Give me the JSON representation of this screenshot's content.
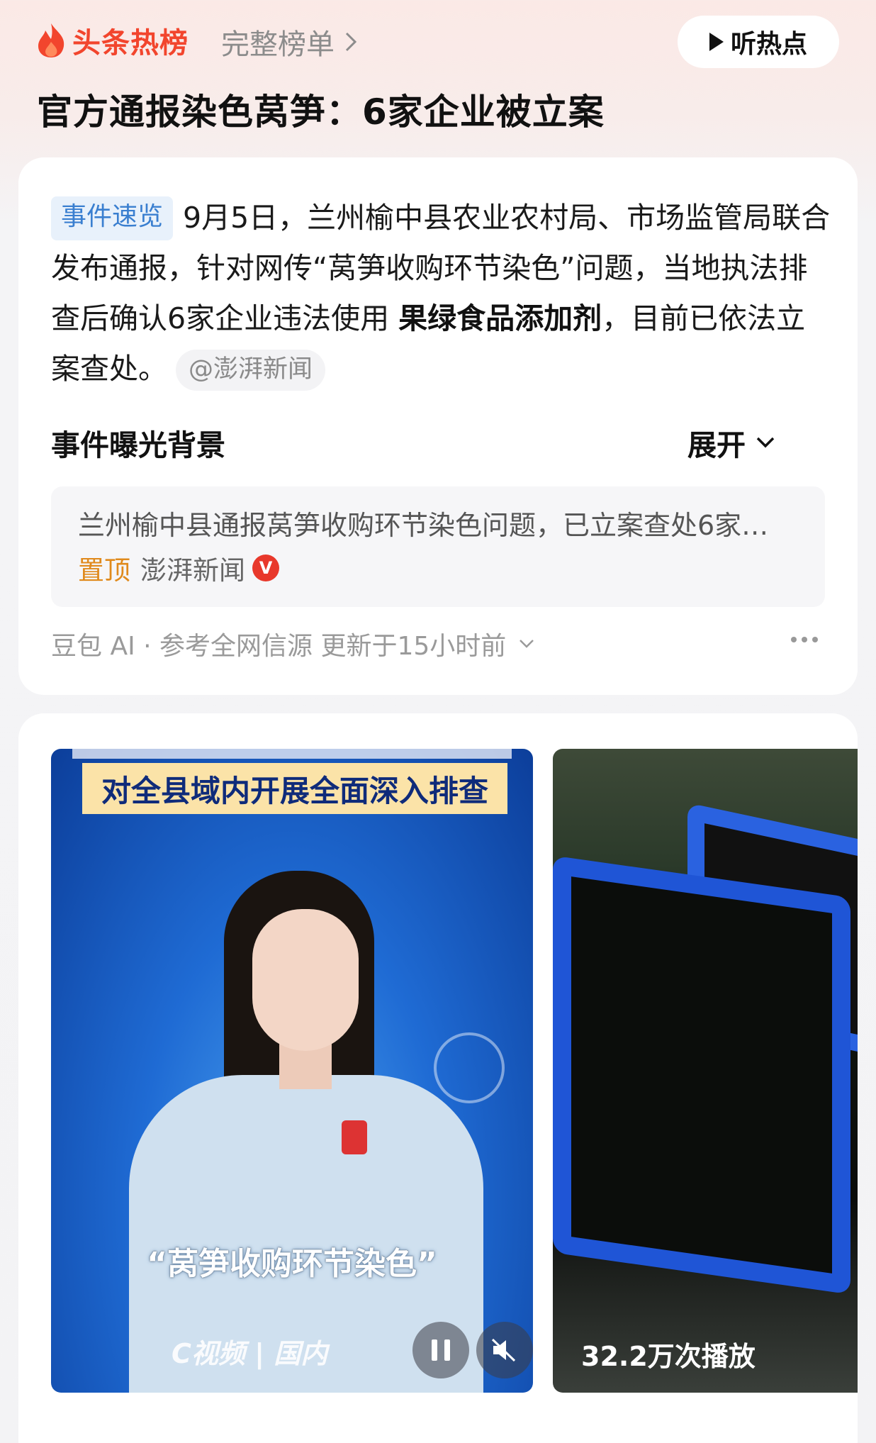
{
  "header": {
    "brand": "头条热榜",
    "full_list": "完整榜单",
    "listen_button": "听热点",
    "headline": "官方通报染色莴笋：6家企业被立案"
  },
  "summary_card": {
    "tag": "事件速览",
    "text_before_bold": "9月5日，兰州榆中县农业农村局、市场监管局联合发布通报，针对网传“莴笋收购环节染色”问题，当地执法排查后确认6家企业违法使用 ",
    "bold_text": "果绿食品添加剂",
    "text_after_bold": "，目前已依法立案查处。",
    "source_chip": "@澎湃新闻",
    "background_title": "事件曝光背景",
    "expand_label": "展开",
    "news_item": {
      "title": "兰州榆中县通报莴笋收购环节染色问题，已立案查处6家…",
      "pin_label": "置顶",
      "source": "澎湃新闻",
      "verified_mark": "V"
    },
    "footer": "豆包 AI · 参考全网信源 更新于15小时前"
  },
  "videos": [
    {
      "banner": "对全县域内开展全面深入排查",
      "subtitle": "“莴笋收购环节染色”",
      "brand": "C视频 | 国内"
    },
    {
      "plays": "32.2万次播放"
    }
  ],
  "icons": {
    "brand_icon": "flame-icon",
    "listen_icon": "play-icon",
    "expand_icon": "chevron-down-icon",
    "more_icon": "more-dots-icon",
    "pause_icon": "pause-icon",
    "mute_icon": "mute-icon"
  },
  "colors": {
    "brand_red": "#f2452d",
    "tag_blue": "#3a7fd0",
    "pin_orange": "#e08a1c",
    "verified_red": "#e8382b"
  }
}
